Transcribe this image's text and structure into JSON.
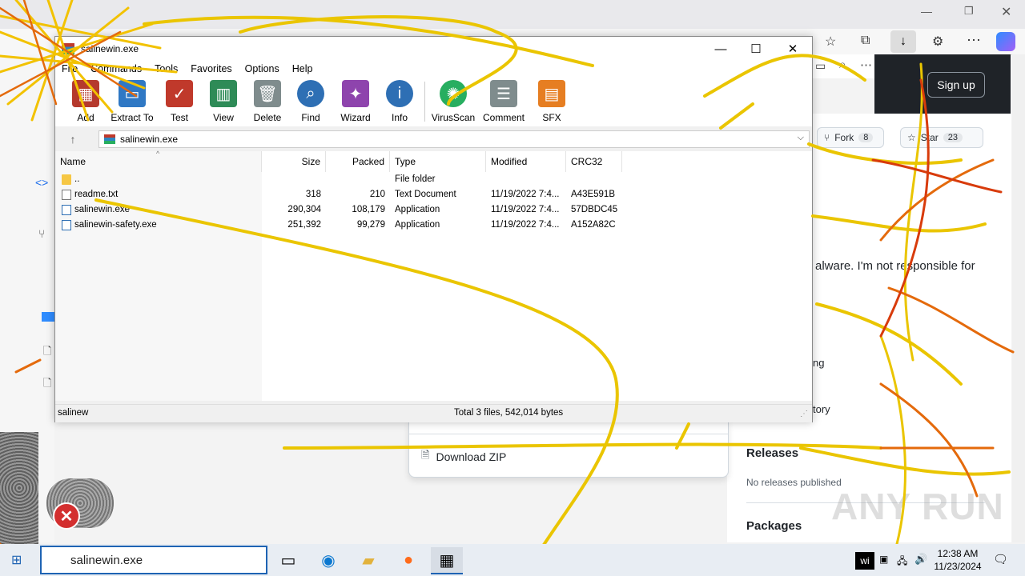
{
  "browser": {
    "signup_label": "Sign up",
    "fork_label": "Fork",
    "fork_count": "8",
    "star_label": "Star",
    "star_count": "23",
    "about_text": "alware. I'm not responsible for",
    "side_item_1": "ng",
    "side_item_2": "tory",
    "releases_heading": "Releases",
    "releases_text": "No releases published",
    "packages_heading": "Packages",
    "download_zip": "Download ZIP",
    "watermark": "ANY RUN"
  },
  "winrar": {
    "title": "salinewin.exe",
    "menu": [
      "File",
      "Commands",
      "Tools",
      "Favorites",
      "Options",
      "Help"
    ],
    "toolbar": [
      {
        "label": "Add",
        "icon": "add-archive-icon",
        "color": "#b5392d"
      },
      {
        "label": "Extract To",
        "icon": "extract-folder-icon",
        "color": "#2f78c4"
      },
      {
        "label": "Test",
        "icon": "test-clipboard-icon",
        "color": "#c0392b"
      },
      {
        "label": "View",
        "icon": "view-book-icon",
        "color": "#2e8b57"
      },
      {
        "label": "Delete",
        "icon": "trash-icon",
        "color": "#7f8c8d"
      },
      {
        "label": "Find",
        "icon": "magnifier-icon",
        "color": "#2e6fb4"
      },
      {
        "label": "Wizard",
        "icon": "wand-icon",
        "color": "#8e44ad"
      },
      {
        "label": "Info",
        "icon": "info-icon",
        "color": "#2e6fb4"
      },
      {
        "label": "VirusScan",
        "icon": "virus-scan-icon",
        "color": "#27ae60"
      },
      {
        "label": "Comment",
        "icon": "comment-icon",
        "color": "#7f8c8d"
      },
      {
        "label": "SFX",
        "icon": "sfx-books-icon",
        "color": "#e67e22"
      }
    ],
    "address": "salinewin.exe",
    "columns": [
      "Name",
      "Size",
      "Packed",
      "Type",
      "Modified",
      "CRC32"
    ],
    "rows": [
      {
        "name": "..",
        "size": "",
        "packed": "",
        "type": "File folder",
        "modified": "",
        "crc": "",
        "icon": "folder"
      },
      {
        "name": "readme.txt",
        "size": "318",
        "packed": "210",
        "type": "Text Document",
        "modified": "11/19/2022 7:4...",
        "crc": "A43E591B",
        "icon": "txt"
      },
      {
        "name": "salinewin.exe",
        "size": "290,304",
        "packed": "108,179",
        "type": "Application",
        "modified": "11/19/2022 7:4...",
        "crc": "57DBDC45",
        "icon": "exe"
      },
      {
        "name": "salinewin-safety.exe",
        "size": "251,392",
        "packed": "99,279",
        "type": "Application",
        "modified": "11/19/2022 7:4...",
        "crc": "A152A82C",
        "icon": "exe"
      }
    ],
    "status_left": "salinew",
    "status_right": "Total 3 files, 542,014 bytes"
  },
  "taskbar": {
    "search_text": "salinewin.exe",
    "tray_text": "wi",
    "time": "12:38 AM",
    "date": "11/23/2024"
  }
}
